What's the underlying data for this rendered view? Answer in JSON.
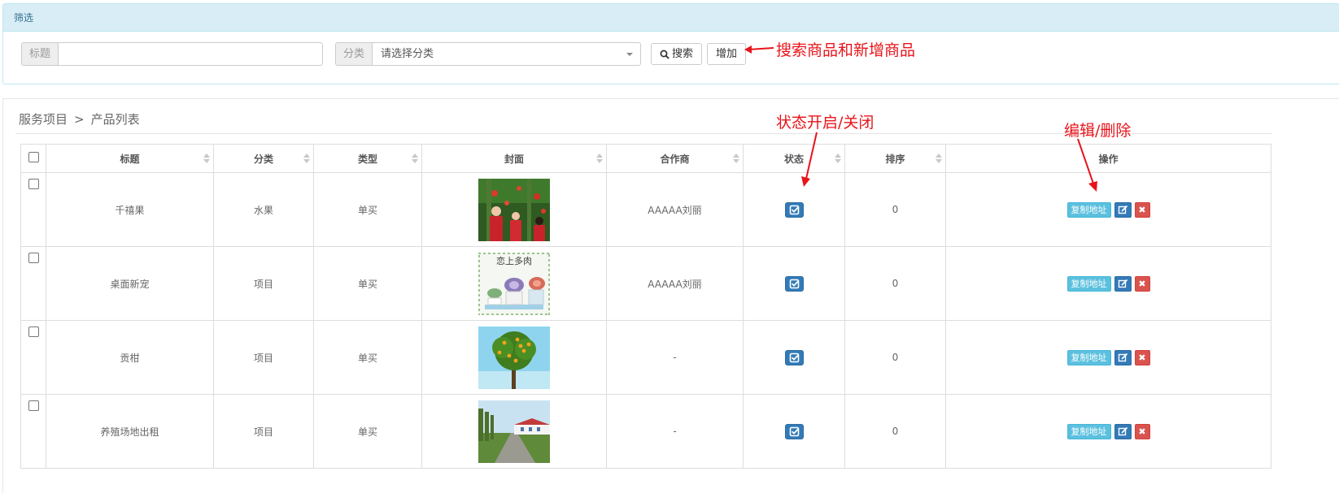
{
  "filter": {
    "heading": "筛选",
    "title_label": "标题",
    "title_value": "",
    "category_label": "分类",
    "category_selected": "请选择分类",
    "search_label": "搜索",
    "add_label": "增加"
  },
  "annotations": {
    "search_add": "搜索商品和新增商品",
    "status_toggle": "状态开启/关闭",
    "edit_delete": "编辑/删除",
    "color": "#e8141b"
  },
  "breadcrumb": {
    "parent": "服务项目",
    "separator": ">",
    "current": "产品列表"
  },
  "table": {
    "headers": [
      "标题",
      "分类",
      "类型",
      "封面",
      "合作商",
      "状态",
      "排序",
      "操作"
    ],
    "rows": [
      {
        "title": "千禧果",
        "category": "水果",
        "type": "单买",
        "cover": "tomato-orchard-photo",
        "partner": "AAAAA刘丽",
        "order": "0"
      },
      {
        "title": "桌面新宠",
        "category": "项目",
        "type": "单买",
        "cover": "succulent-poster",
        "cover_text": "恋上多肉",
        "partner": "AAAAA刘丽",
        "order": "0"
      },
      {
        "title": "贡柑",
        "category": "项目",
        "type": "单买",
        "cover": "orange-tree-photo",
        "partner": "-",
        "order": "0"
      },
      {
        "title": "养殖场地出租",
        "category": "项目",
        "type": "单买",
        "cover": "farm-buildings-photo",
        "partner": "-",
        "order": "0"
      }
    ],
    "copy_label": "复制地址"
  },
  "colors": {
    "primary": "#337ab7",
    "info": "#5bc0de",
    "danger": "#d9534f",
    "panel_heading": "#d9edf7"
  }
}
